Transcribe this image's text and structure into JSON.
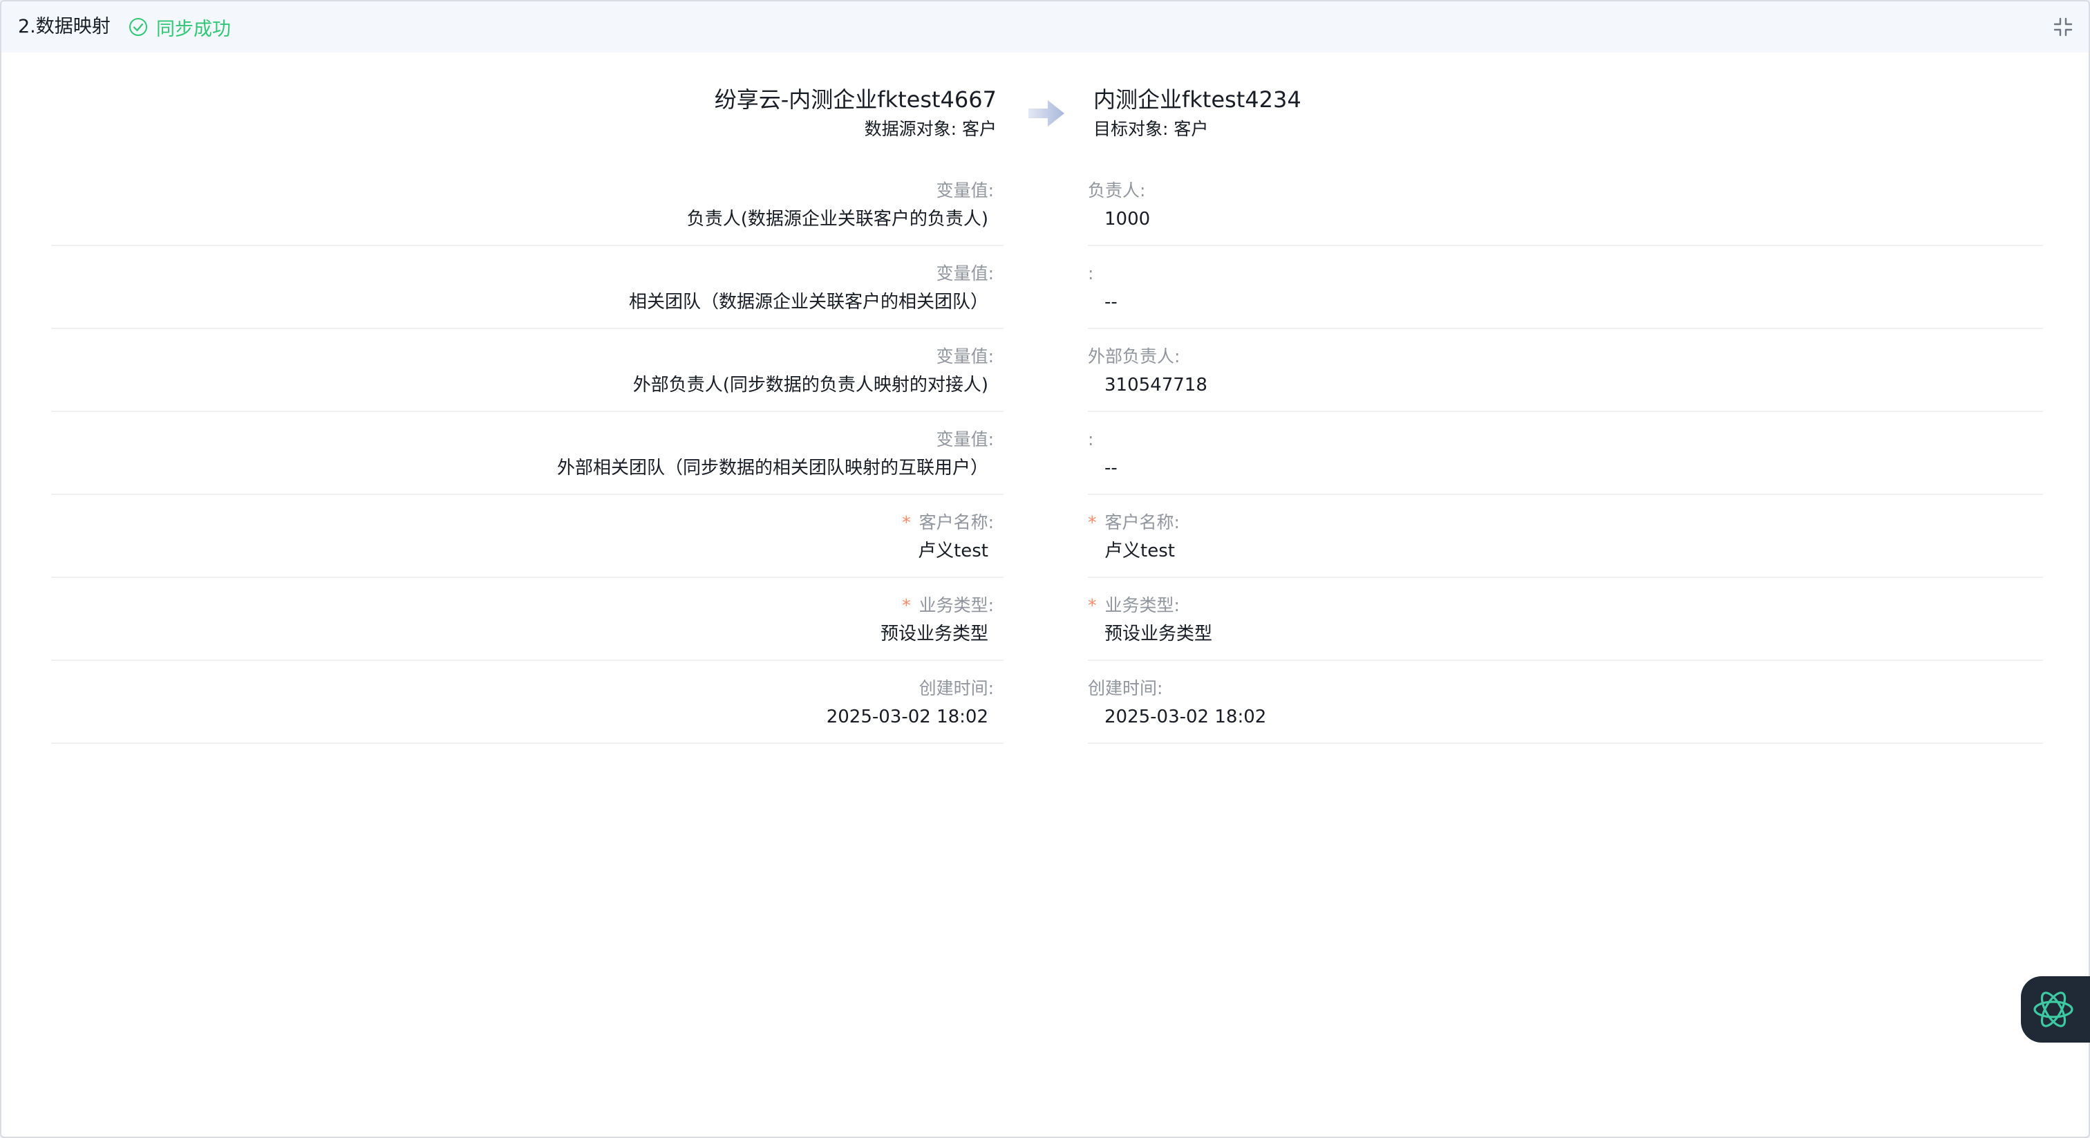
{
  "header": {
    "title": "2.数据映射",
    "status": "同步成功"
  },
  "mapping": {
    "source": {
      "name": "纷享云-内测企业fktest4667",
      "object_label": "数据源对象:",
      "object_value": "客户"
    },
    "target": {
      "name": "内测企业fktest4234",
      "object_label": "目标对象:",
      "object_value": "客户"
    }
  },
  "rows": [
    {
      "left_label": "变量值:",
      "left_value": "负责人(数据源企业关联客户的负责人)",
      "right_label": "负责人:",
      "right_value": "1000",
      "required": false
    },
    {
      "left_label": "变量值:",
      "left_value": "相关团队（数据源企业关联客户的相关团队）",
      "right_label": ":",
      "right_value": "--",
      "required": false
    },
    {
      "left_label": "变量值:",
      "left_value": "外部负责人(同步数据的负责人映射的对接人)",
      "right_label": "外部负责人:",
      "right_value": "310547718",
      "required": false
    },
    {
      "left_label": "变量值:",
      "left_value": "外部相关团队（同步数据的相关团队映射的互联用户）",
      "right_label": ":",
      "right_value": "--",
      "required": false
    },
    {
      "left_label": "客户名称:",
      "left_value": "卢义test",
      "right_label": "客户名称:",
      "right_value": "卢义test",
      "required": true
    },
    {
      "left_label": "业务类型:",
      "left_value": "预设业务类型",
      "right_label": "业务类型:",
      "right_value": "预设业务类型",
      "required": true
    },
    {
      "left_label": "创建时间:",
      "left_value": "2025-03-02 18:02",
      "right_label": "创建时间:",
      "right_value": "2025-03-02 18:02",
      "required": false
    }
  ],
  "required_mark": "*",
  "icons": {
    "status": "check-circle-icon",
    "collapse": "collapse-icon",
    "arrow": "arrow-right-icon",
    "assistant": "ai-assistant-icon"
  },
  "colors": {
    "success": "#30c776",
    "required": "#ff8a66",
    "label": "#91959e",
    "text": "#181c25",
    "header_bg": "#f4f7fb",
    "arrow": "#b8c4e0"
  }
}
